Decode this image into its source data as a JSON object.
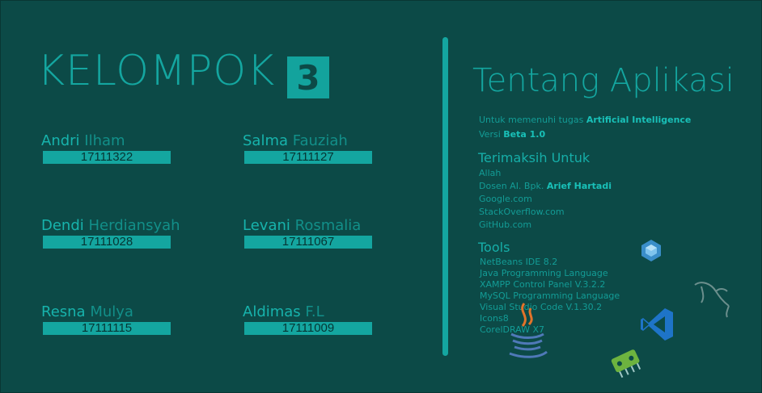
{
  "header": {
    "title": "KELOMPOK",
    "number": "3"
  },
  "members": [
    {
      "first": "Andri",
      "last": "Ilham",
      "id": "17111322"
    },
    {
      "first": "Salma",
      "last": "Fauziah",
      "id": "17111127"
    },
    {
      "first": "Dendi",
      "last": "Herdiansyah",
      "id": "17111028"
    },
    {
      "first": "Levani",
      "last": "Rosmalia",
      "id": "17111067"
    },
    {
      "first": "Resna",
      "last": "Mulya",
      "id": "17111115"
    },
    {
      "first": "Aldimas",
      "last": "F.L",
      "id": "17111009"
    }
  ],
  "about": {
    "title": "Tentang Aplikasi",
    "purpose_prefix": "Untuk memenuhi tugas ",
    "purpose_value": "Artificial Intelligence",
    "version_prefix": "Versi ",
    "version_value": "Beta 1.0",
    "thanks_title": "Terimaksih Untuk",
    "thanks": {
      "allah": "Allah",
      "dosen_prefix": "Dosen AI. Bpk. ",
      "dosen_name": "Arief Hartadi",
      "google": "Google.com",
      "stackoverflow": "StackOverflow.com",
      "github": "GitHub.com"
    },
    "tools_title": "Tools",
    "tools": [
      "NetBeans IDE 8.2",
      "Java Programming Language",
      "XAMPP Control Panel V.3.2.2",
      "MySQL Programming Language",
      "Visual Studio Code V.1.30.2",
      "Icons8",
      "CorelDRAW X7"
    ]
  },
  "icons": [
    "netbeans-icon",
    "mysql-icon",
    "vscode-icon",
    "java-icon",
    "xampp-icon"
  ],
  "colors": {
    "background": "#0c4a47",
    "accent": "#14a6a0",
    "highlight": "#19c0b8"
  }
}
